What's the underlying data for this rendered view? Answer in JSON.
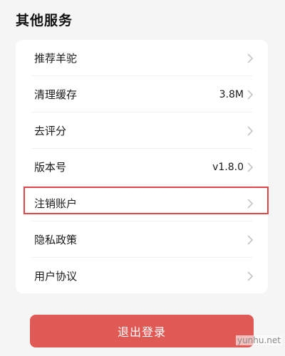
{
  "section": {
    "title": "其他服务"
  },
  "menu": {
    "items": [
      {
        "label": "推荐羊驼",
        "value": "",
        "icon": "chevron-right-icon"
      },
      {
        "label": "清理缓存",
        "value": "3.8M",
        "icon": "chevron-right-icon"
      },
      {
        "label": "去评分",
        "value": "",
        "icon": "chevron-right-icon"
      },
      {
        "label": "版本号",
        "value": "v1.8.0",
        "icon": "chevron-right-icon"
      },
      {
        "label": "注销账户",
        "value": "",
        "icon": "chevron-right-icon"
      },
      {
        "label": "隐私政策",
        "value": "",
        "icon": "chevron-right-icon"
      },
      {
        "label": "用户协议",
        "value": "",
        "icon": "chevron-right-icon"
      }
    ]
  },
  "logout": {
    "label": "退出登录"
  },
  "watermark": {
    "text": "yunhu.net"
  },
  "colors": {
    "background": "#f5f5f5",
    "card": "#ffffff",
    "logout_button": "#e05a55",
    "highlight_border": "#e0454a",
    "chevron": "#c4c4c4"
  }
}
